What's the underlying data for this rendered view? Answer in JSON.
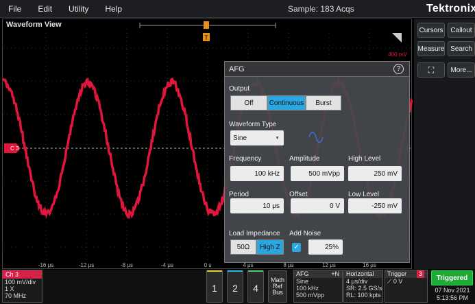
{
  "menu": {
    "items": [
      "File",
      "Edit",
      "Utility",
      "Help"
    ],
    "sample_status": "Sample: 183 Acqs",
    "logo": "Tektronix"
  },
  "waveform_view": {
    "title": "Waveform View",
    "scale_marker": "400 mV",
    "channel_marker": "C 3",
    "x_ticks": [
      "-16 μs",
      "-12 μs",
      "-8 μs",
      "-4 μs",
      "0 s",
      "4 μs",
      "8 μs",
      "12 μs",
      "16 μs"
    ],
    "trace_color": "#e0163c"
  },
  "sidebar": {
    "buttons": [
      "Cursors",
      "Callout",
      "Measure",
      "Search",
      "More..."
    ]
  },
  "afg_dialog": {
    "title": "AFG",
    "output_label": "Output",
    "output_options": [
      "Off",
      "Continuous",
      "Burst"
    ],
    "output_selected": "Continuous",
    "waveform_type_label": "Waveform Type",
    "waveform_type_value": "Sine",
    "frequency_label": "Frequency",
    "frequency_value": "100 kHz",
    "amplitude_label": "Amplitude",
    "amplitude_value": "500 mVpp",
    "high_level_label": "High Level",
    "high_level_value": "250 mV",
    "period_label": "Period",
    "period_value": "10 μs",
    "offset_label": "Offset",
    "offset_value": "0 V",
    "low_level_label": "Low Level",
    "low_level_value": "-250 mV",
    "load_impedance_label": "Load Impedance",
    "load_options": [
      "50Ω",
      "High Z"
    ],
    "load_selected": "High Z",
    "add_noise_label": "Add Noise",
    "noise_checked": true,
    "noise_value": "25%"
  },
  "bottom_bar": {
    "ch3": {
      "tag": "Ch 3",
      "scale": "100 mV/div",
      "probe": "1 X",
      "bandwidth": "70 MHz"
    },
    "channel_buttons": [
      "1",
      "2",
      "4"
    ],
    "math_ref_bus": [
      "Math",
      "Ref",
      "Bus"
    ],
    "afg": {
      "title": "AFG",
      "noise_tag": "+N",
      "lines": [
        "Sine",
        "100 kHz",
        "500 mVpp"
      ]
    },
    "horizontal": {
      "title": "Horizontal",
      "lines": [
        "4 μs/div",
        "SR: 2.5 GS/s",
        "RL: 100 kpts"
      ]
    },
    "trigger": {
      "title": "Trigger",
      "source": "3",
      "level": "0 V"
    },
    "status": "Triggered",
    "date": "07 Nov 2021",
    "time": "5:13:56 PM"
  }
}
